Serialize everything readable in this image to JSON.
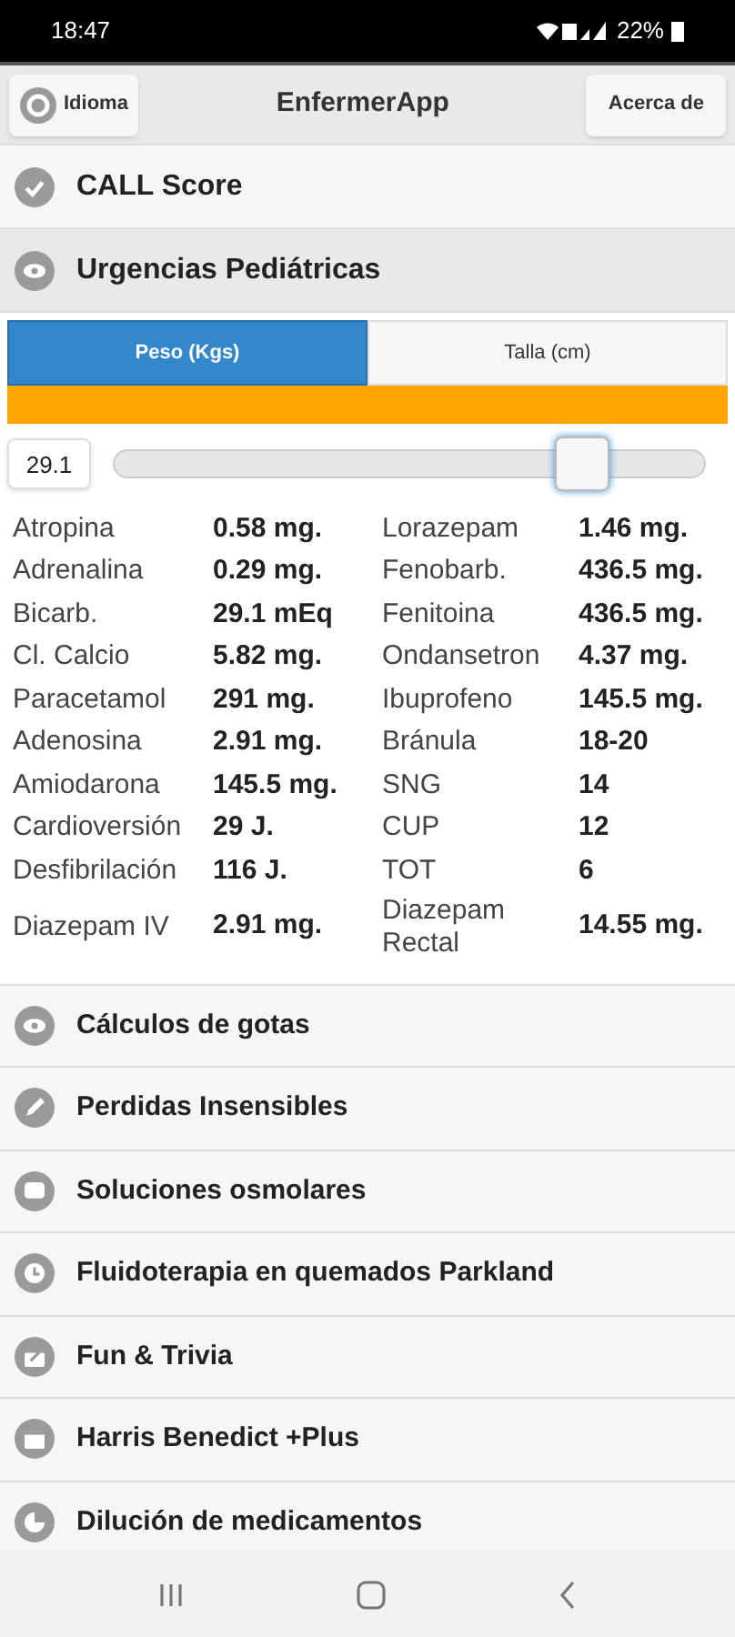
{
  "status_bar": {
    "time": "18:47",
    "battery": "22%"
  },
  "header": {
    "left_button": "Idioma",
    "title": "EnfermerApp",
    "right_button": "Acerca de"
  },
  "sections": [
    {
      "label": "CALL Score",
      "kind": "check",
      "expanded": false
    },
    {
      "label": "Urgencias Pediátricas",
      "kind": "eye",
      "expanded": true
    }
  ],
  "tabs": [
    {
      "label": "Peso (Kgs)",
      "selected": true
    },
    {
      "label": "Talla (cm)",
      "selected": false
    }
  ],
  "weight": {
    "value": "29.1",
    "level": 0.79
  },
  "doses": [
    {
      "drug_1": "Atropina",
      "dose_1": "0.58 mg.",
      "drug_2": "Lorazepam",
      "dose_2": "1.46 mg."
    },
    {
      "drug_1": "Adrenalina",
      "dose_1": "0.29 mg.",
      "drug_2": "Fenobarb.",
      "dose_2": "436.5 mg."
    },
    {
      "drug_1": "Bicarb.",
      "dose_1": "29.1 mEq",
      "drug_2": "Fenitoina",
      "dose_2": "436.5 mg."
    },
    {
      "drug_1": "Cl. Calcio",
      "dose_1": "5.82 mg.",
      "drug_2": "Ondansetron",
      "dose_2": "4.37 mg."
    },
    {
      "drug_1": "Paracetamol",
      "dose_1": "291 mg.",
      "drug_2": "Ibuprofeno",
      "dose_2": "145.5 mg."
    },
    {
      "drug_1": "Adenosina",
      "dose_1": "2.91 mg.",
      "drug_2": "Bránula",
      "dose_2": "18-20"
    },
    {
      "drug_1": "Amiodarona",
      "dose_1": "145.5 mg.",
      "drug_2": "SNG",
      "dose_2": "14"
    },
    {
      "drug_1": "Cardioversión",
      "dose_1": "29 J.",
      "drug_2": "CUP",
      "dose_2": "12"
    },
    {
      "drug_1": "Desfibrilación",
      "dose_1": "116 J.",
      "drug_2": "TOT",
      "dose_2": "6"
    },
    {
      "drug_1": "Diazepam IV",
      "dose_1": "2.91 mg.",
      "drug_2": "Diazepam Rectal",
      "dose_2": "14.55 mg."
    }
  ],
  "menu": [
    {
      "label": "Cálculos de gotas",
      "kind": "eye"
    },
    {
      "label": "Perdidas Insensibles",
      "kind": "pencil"
    },
    {
      "label": "Soluciones osmolares",
      "kind": "chat"
    },
    {
      "label": "Fluidoterapia en quemados Parkland",
      "kind": "clock"
    },
    {
      "label": "Fun & Trivia",
      "kind": "share"
    },
    {
      "label": "Harris Benedict +Plus",
      "kind": "calendar"
    },
    {
      "label": "Dilución de medicamentos",
      "kind": "pie"
    }
  ]
}
